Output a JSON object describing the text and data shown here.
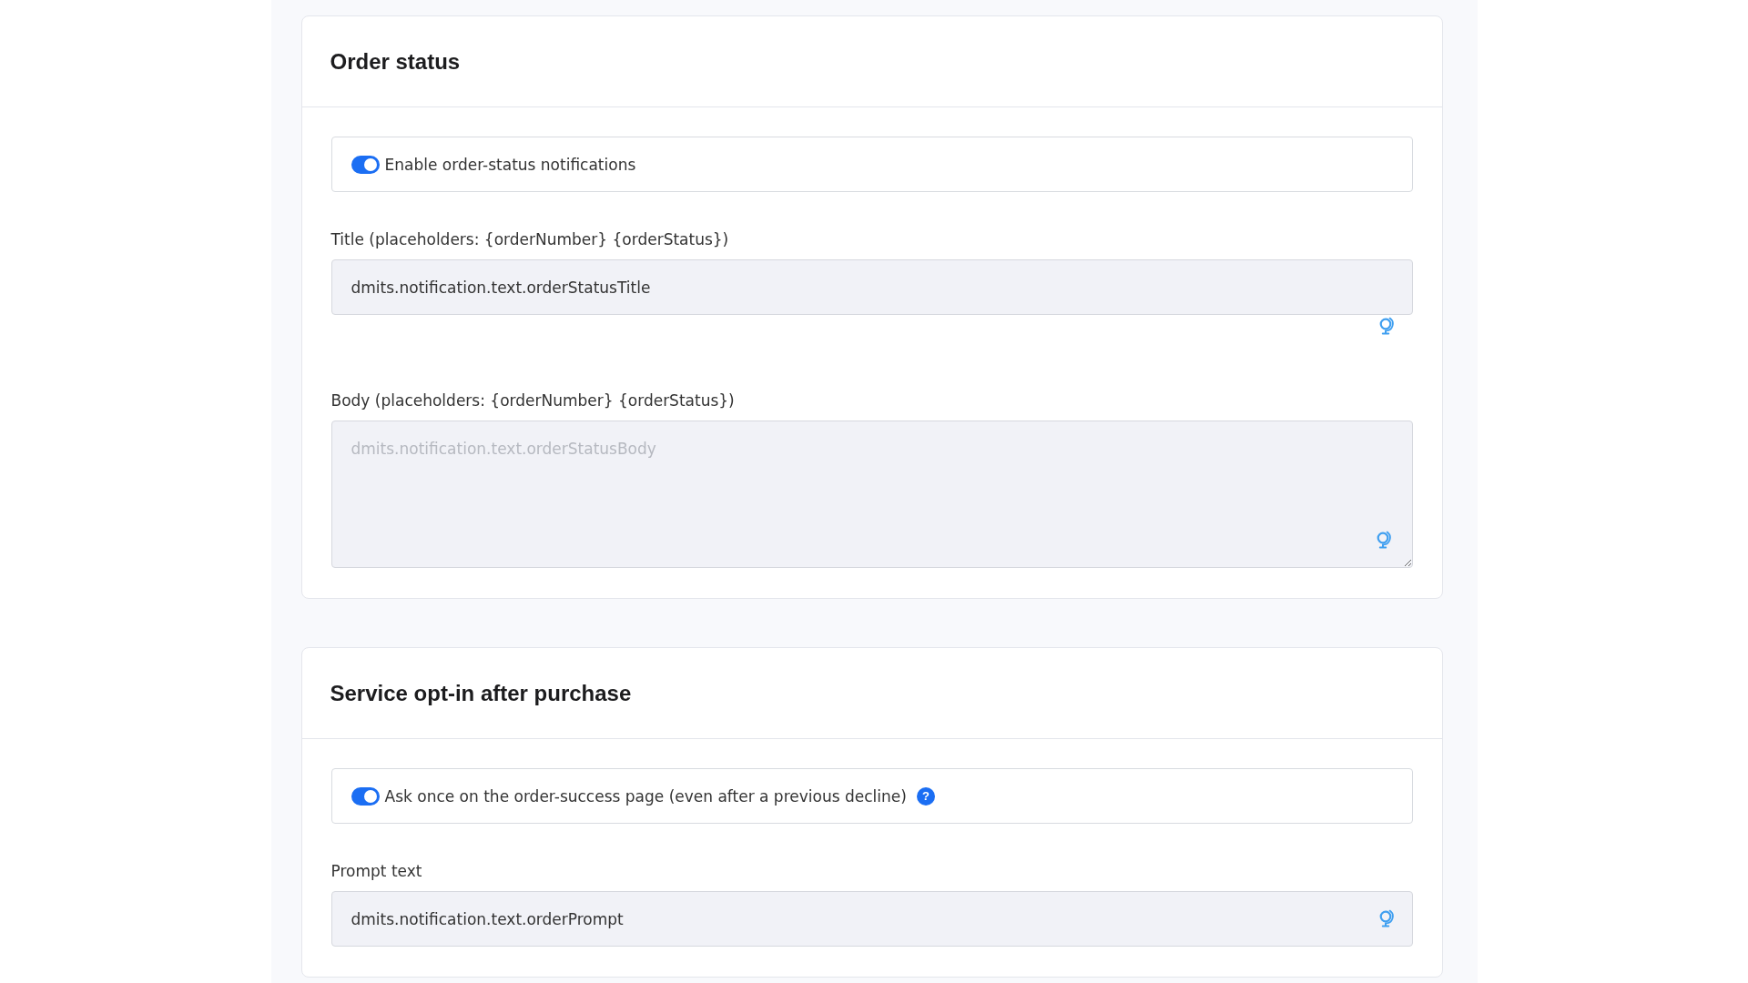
{
  "sections": [
    {
      "title": "Order status",
      "fields": [
        {
          "kind": "toggle",
          "label": "Enable order-status notifications",
          "on": true
        },
        {
          "kind": "stacked",
          "label": "Title (placeholders: {orderNumber} {orderStatus})",
          "value": "dmits.notification.text.orderStatusTitle"
        },
        {
          "kind": "textarea",
          "label": "Body (placeholders: {orderNumber} {orderStatus})",
          "placeholder": "dmits.notification.text.orderStatusBody"
        }
      ]
    },
    {
      "title": "Service opt-in after purchase",
      "fields": [
        {
          "kind": "toggle",
          "label": "Ask once on the order-success page (even after a previous decline)",
          "on": true,
          "help": "?"
        },
        {
          "kind": "input",
          "label": "Prompt text",
          "value": "dmits.notification.text.orderPrompt"
        }
      ]
    }
  ]
}
